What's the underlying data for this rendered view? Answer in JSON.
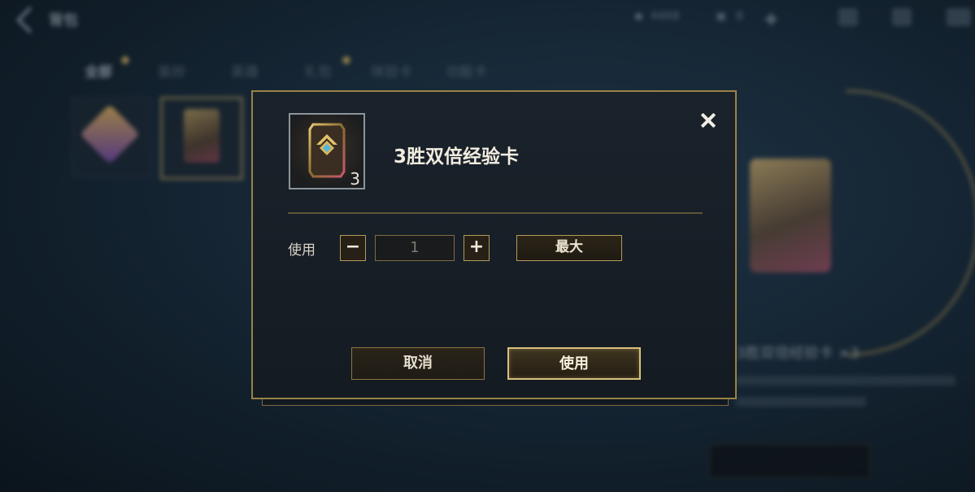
{
  "background": {
    "page_title": "背包",
    "currency_value": "4468",
    "currency2_value": "8",
    "tabs": [
      {
        "label": "全部"
      },
      {
        "label": "装扮"
      },
      {
        "label": "英雄"
      },
      {
        "label": "礼包"
      },
      {
        "label": "体验卡"
      },
      {
        "label": "功能卡"
      }
    ],
    "side_item_name": "3胜双倍经验卡 ×3"
  },
  "dialog": {
    "item_name": "3胜双倍经验卡",
    "item_count": "3",
    "use_label": "使用",
    "minus_symbol": "−",
    "plus_symbol": "+",
    "quantity": "1",
    "max_label": "最大",
    "cancel_label": "取消",
    "confirm_label": "使用"
  },
  "colors": {
    "accent_gold": "#b39a5c",
    "modal_border": "#9a8347",
    "background_blue": "#13222f"
  }
}
